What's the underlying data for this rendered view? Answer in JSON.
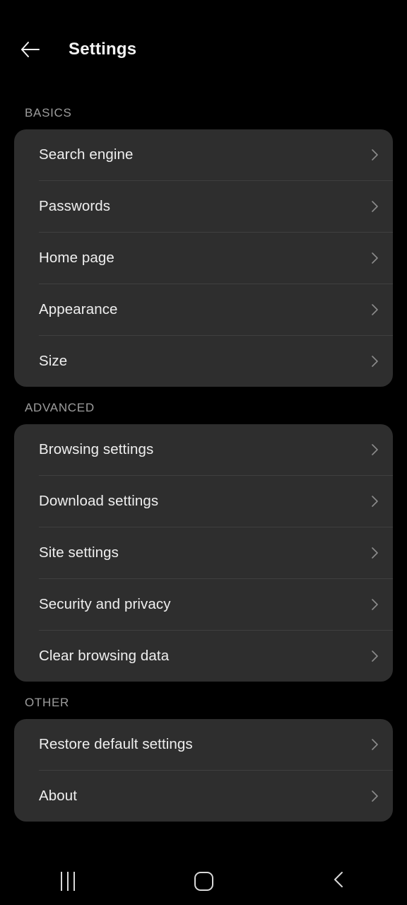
{
  "appbar": {
    "back_icon": "arrow-left-icon",
    "title": "Settings"
  },
  "sections": [
    {
      "header": "BASICS",
      "items": [
        {
          "label": "Search engine",
          "chevron": "chevron-right-icon"
        },
        {
          "label": "Passwords",
          "chevron": "chevron-right-icon"
        },
        {
          "label": "Home page",
          "chevron": "chevron-right-icon"
        },
        {
          "label": "Appearance",
          "chevron": "chevron-right-icon"
        },
        {
          "label": "Size",
          "chevron": "chevron-right-icon"
        }
      ]
    },
    {
      "header": "ADVANCED",
      "items": [
        {
          "label": "Browsing settings",
          "chevron": "chevron-right-icon"
        },
        {
          "label": "Download settings",
          "chevron": "chevron-right-icon"
        },
        {
          "label": "Site settings",
          "chevron": "chevron-right-icon"
        },
        {
          "label": "Security and privacy",
          "chevron": "chevron-right-icon"
        },
        {
          "label": "Clear browsing data",
          "chevron": "chevron-right-icon"
        }
      ]
    },
    {
      "header": "OTHER",
      "items": [
        {
          "label": "Restore default settings",
          "chevron": "chevron-right-icon"
        },
        {
          "label": "About",
          "chevron": "chevron-right-icon"
        }
      ]
    }
  ],
  "navbar": {
    "recents": "recents-icon",
    "home": "home-icon",
    "back": "back-icon"
  },
  "colors": {
    "background": "#000000",
    "card": "#2e2e2e",
    "divider": "#3f3f3f",
    "label": "#efefef",
    "section_header": "#9d9d9d",
    "chevron": "#8c8c8c",
    "nav_icon": "#d8d8d8"
  }
}
